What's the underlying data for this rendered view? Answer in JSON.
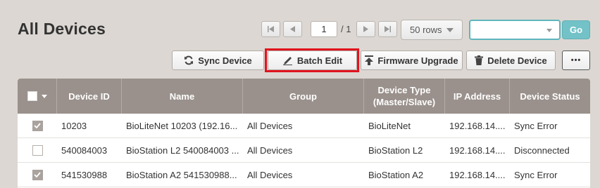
{
  "page": {
    "title": "All Devices"
  },
  "pager": {
    "current_page": "1",
    "total_label": "/ 1"
  },
  "rows_select": {
    "value": "50 rows"
  },
  "search": {
    "value": "",
    "go_label": "Go"
  },
  "toolbar": {
    "sync_label": "Sync Device",
    "batch_edit_label": "Batch Edit",
    "firmware_label": "Firmware Upgrade",
    "delete_label": "Delete Device",
    "more_label": "•••"
  },
  "table": {
    "headers": {
      "device_id": "Device ID",
      "name": "Name",
      "group": "Group",
      "device_type": "Device Type",
      "device_type_sub": "(Master/Slave)",
      "ip": "IP Address",
      "status": "Device Status"
    },
    "rows": [
      {
        "checked": true,
        "device_id": "10203",
        "name": "BioLiteNet 10203 (192.16...",
        "group": "All Devices",
        "device_type": "BioLiteNet",
        "ip": "192.168.14....",
        "status": "Sync Error"
      },
      {
        "checked": false,
        "device_id": "540084003",
        "name": "BioStation L2 540084003 ...",
        "group": "All Devices",
        "device_type": "BioStation L2",
        "ip": "192.168.14....",
        "status": "Disconnected"
      },
      {
        "checked": true,
        "device_id": "541530988",
        "name": "BioStation A2 541530988...",
        "group": "All Devices",
        "device_type": "BioStation A2",
        "ip": "192.168.14....",
        "status": "Sync Error"
      }
    ]
  }
}
